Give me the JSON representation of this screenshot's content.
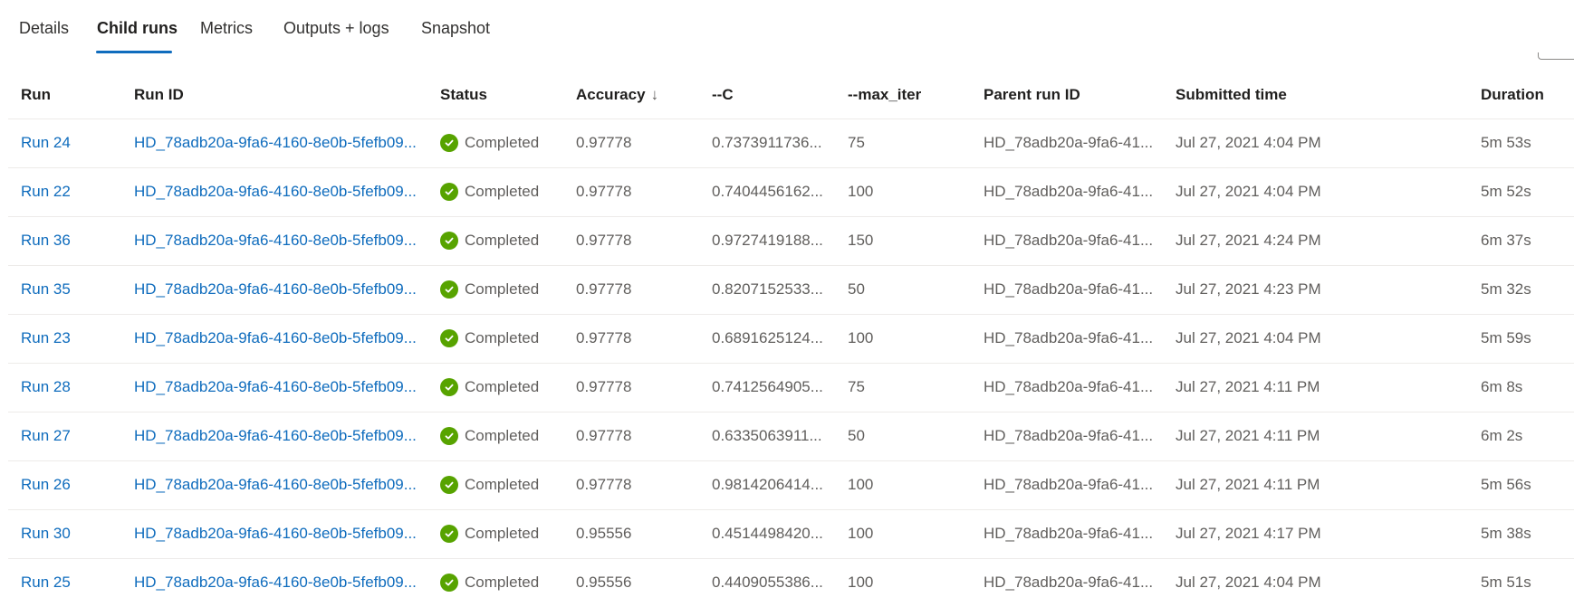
{
  "tabs": [
    {
      "label": "Details"
    },
    {
      "label": "Child runs"
    },
    {
      "label": "Metrics"
    },
    {
      "label": "Outputs + logs"
    },
    {
      "label": "Snapshot"
    }
  ],
  "active_tab": "Child runs",
  "table": {
    "columns": [
      "Run",
      "Run ID",
      "Status",
      "Accuracy",
      "--C",
      "--max_iter",
      "Parent run ID",
      "Submitted time",
      "Duration"
    ],
    "sort": {
      "column": "Accuracy",
      "direction": "descending",
      "icon": "arrow-down-icon",
      "glyph": "↓"
    },
    "status_color": "#57a300",
    "link_color": "#0f6cbd",
    "rows": [
      {
        "run": "Run 24",
        "run_id": "HD_78adb20a-9fa6-4160-8e0b-5fefb09...",
        "status": "Completed",
        "accuracy": "0.97778",
        "c": "0.7373911736...",
        "max_iter": "75",
        "parent": "HD_78adb20a-9fa6-41...",
        "submitted": "Jul 27, 2021 4:04 PM",
        "duration": "5m 53s"
      },
      {
        "run": "Run 22",
        "run_id": "HD_78adb20a-9fa6-4160-8e0b-5fefb09...",
        "status": "Completed",
        "accuracy": "0.97778",
        "c": "0.7404456162...",
        "max_iter": "100",
        "parent": "HD_78adb20a-9fa6-41...",
        "submitted": "Jul 27, 2021 4:04 PM",
        "duration": "5m 52s"
      },
      {
        "run": "Run 36",
        "run_id": "HD_78adb20a-9fa6-4160-8e0b-5fefb09...",
        "status": "Completed",
        "accuracy": "0.97778",
        "c": "0.9727419188...",
        "max_iter": "150",
        "parent": "HD_78adb20a-9fa6-41...",
        "submitted": "Jul 27, 2021 4:24 PM",
        "duration": "6m 37s"
      },
      {
        "run": "Run 35",
        "run_id": "HD_78adb20a-9fa6-4160-8e0b-5fefb09...",
        "status": "Completed",
        "accuracy": "0.97778",
        "c": "0.8207152533...",
        "max_iter": "50",
        "parent": "HD_78adb20a-9fa6-41...",
        "submitted": "Jul 27, 2021 4:23 PM",
        "duration": "5m 32s"
      },
      {
        "run": "Run 23",
        "run_id": "HD_78adb20a-9fa6-4160-8e0b-5fefb09...",
        "status": "Completed",
        "accuracy": "0.97778",
        "c": "0.6891625124...",
        "max_iter": "100",
        "parent": "HD_78adb20a-9fa6-41...",
        "submitted": "Jul 27, 2021 4:04 PM",
        "duration": "5m 59s"
      },
      {
        "run": "Run 28",
        "run_id": "HD_78adb20a-9fa6-4160-8e0b-5fefb09...",
        "status": "Completed",
        "accuracy": "0.97778",
        "c": "0.7412564905...",
        "max_iter": "75",
        "parent": "HD_78adb20a-9fa6-41...",
        "submitted": "Jul 27, 2021 4:11 PM",
        "duration": "6m 8s"
      },
      {
        "run": "Run 27",
        "run_id": "HD_78adb20a-9fa6-4160-8e0b-5fefb09...",
        "status": "Completed",
        "accuracy": "0.97778",
        "c": "0.6335063911...",
        "max_iter": "50",
        "parent": "HD_78adb20a-9fa6-41...",
        "submitted": "Jul 27, 2021 4:11 PM",
        "duration": "6m 2s"
      },
      {
        "run": "Run 26",
        "run_id": "HD_78adb20a-9fa6-4160-8e0b-5fefb09...",
        "status": "Completed",
        "accuracy": "0.97778",
        "c": "0.9814206414...",
        "max_iter": "100",
        "parent": "HD_78adb20a-9fa6-41...",
        "submitted": "Jul 27, 2021 4:11 PM",
        "duration": "5m 56s"
      },
      {
        "run": "Run 30",
        "run_id": "HD_78adb20a-9fa6-4160-8e0b-5fefb09...",
        "status": "Completed",
        "accuracy": "0.95556",
        "c": "0.4514498420...",
        "max_iter": "100",
        "parent": "HD_78adb20a-9fa6-41...",
        "submitted": "Jul 27, 2021 4:17 PM",
        "duration": "5m 38s"
      },
      {
        "run": "Run 25",
        "run_id": "HD_78adb20a-9fa6-4160-8e0b-5fefb09...",
        "status": "Completed",
        "accuracy": "0.95556",
        "c": "0.4409055386...",
        "max_iter": "100",
        "parent": "HD_78adb20a-9fa6-41...",
        "submitted": "Jul 27, 2021 4:04 PM",
        "duration": "5m 51s"
      }
    ]
  }
}
